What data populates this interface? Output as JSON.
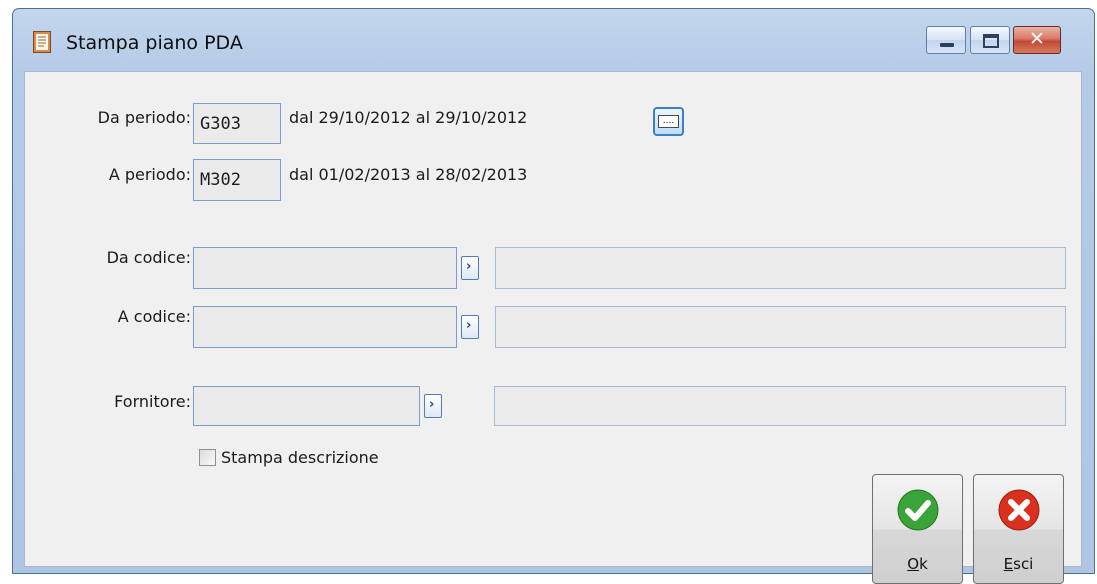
{
  "window": {
    "title": "Stampa piano PDA",
    "close_glyph": "✕"
  },
  "periods": {
    "da_label": "Da periodo:",
    "da_code": "G303",
    "da_range": "dal 29/10/2012   al 29/10/2012",
    "a_label": "A periodo:",
    "a_code": "M302",
    "a_range": "dal 01/02/2013   al 28/02/2013",
    "select_button_glyph": "...."
  },
  "codes": {
    "da_label": "Da codice:",
    "a_label": "A codice:",
    "da_value": "",
    "a_value": "",
    "da_desc": "",
    "a_desc": ""
  },
  "supplier": {
    "label": "Fornitore:",
    "value": "",
    "desc": ""
  },
  "print_description": {
    "label": "Stampa descrizione",
    "checked": false
  },
  "zoom_glyph": "›",
  "buttons": {
    "ok": {
      "label": "Ok",
      "icon": "check-icon",
      "color": "#3aa33a"
    },
    "esci": {
      "label": "Esci",
      "icon": "close-icon",
      "color": "#d9311e"
    }
  }
}
